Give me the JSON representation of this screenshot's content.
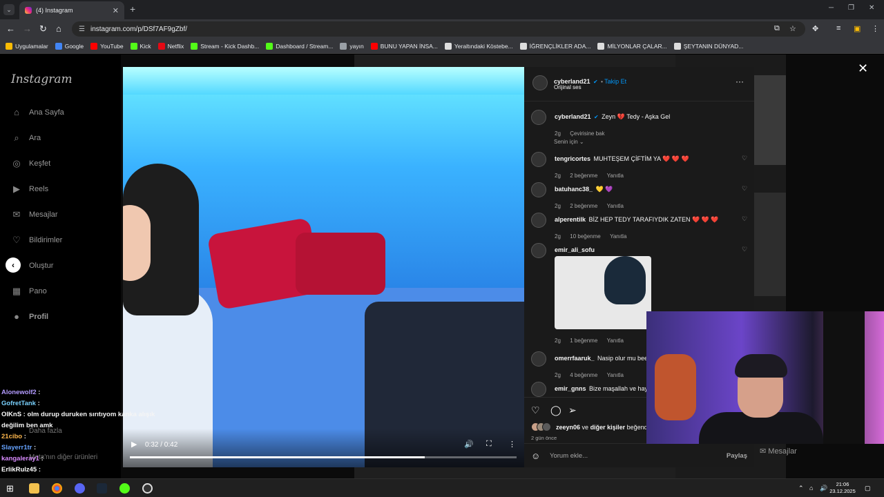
{
  "browser": {
    "tab_title": "(4) Instagram",
    "tab_close": "✕",
    "new_tab": "+",
    "url": "instagram.com/p/DSf7AF9gZbf/",
    "bookmarks": [
      {
        "label": "Uygulamalar",
        "color": "#fbbc05"
      },
      {
        "label": "Google",
        "color": "#4285f4"
      },
      {
        "label": "YouTube",
        "color": "#ff0000"
      },
      {
        "label": "Kick",
        "color": "#53fc18"
      },
      {
        "label": "Netflix",
        "color": "#e50914"
      },
      {
        "label": "Stream - Kick Dashb...",
        "color": "#53fc18"
      },
      {
        "label": "Dashboard / Stream...",
        "color": "#53fc18"
      },
      {
        "label": "yayın",
        "color": "#9aa0a6"
      },
      {
        "label": "BUNU YAPAN İNSA...",
        "color": "#ff0000"
      },
      {
        "label": "Yeraltındaki Köstebe...",
        "color": "#dddddd"
      },
      {
        "label": "İĞRENÇLİKLER ADA...",
        "color": "#dddddd"
      },
      {
        "label": "MİLYONLAR ÇALAR...",
        "color": "#dddddd"
      },
      {
        "label": "ŞEYTANIN DÜNYAD...",
        "color": "#dddddd"
      }
    ]
  },
  "instagram": {
    "logo": "Instagram",
    "nav": [
      "Ana Sayfa",
      "Ara",
      "Keşfet",
      "Reels",
      "Mesajlar",
      "Bildirimler",
      "Oluştur",
      "Pano",
      "Profil"
    ],
    "more": "Daha fazla",
    "meta_products": "Meta'nın diğer ürünleri",
    "messages_dock": "Mesajlar"
  },
  "post": {
    "author": "cyberland21",
    "follow": "Takip Et",
    "audio": "Orijinal ses",
    "more_icon": "···",
    "caption_user": "cyberland21",
    "caption_text": "Zeyn 💔 Tedy - Aşka Gel",
    "caption_age": "2g",
    "caption_translate": "Çevirisine bak",
    "sort_label": "Senin için",
    "comments": [
      {
        "user": "tengricortes",
        "text": "MUHTEŞEM ÇİFTİM YA ❤️ ❤️ ❤️",
        "age": "2g",
        "likes": "2 beğenme",
        "reply": "Yanıtla"
      },
      {
        "user": "batuhanc38_",
        "text": "💛 💜",
        "age": "2g",
        "likes": "2 beğenme",
        "reply": "Yanıtla"
      },
      {
        "user": "alperentilk",
        "text": "BİZ HEP TEDY TARAFIYDIK ZATEN ❤️ ❤️ ❤️",
        "age": "2g",
        "likes": "10 beğenme",
        "reply": "Yanıtla"
      },
      {
        "user": "emir_ali_sofu",
        "text": "",
        "age": "2g",
        "likes": "1 beğenme",
        "reply": "Yanıtla"
      },
      {
        "user": "omerrfaaruk_",
        "text": "Nasip olur mu bee",
        "age": "2g",
        "likes": "4 beğenme",
        "reply": "Yanıtla"
      },
      {
        "user": "emir_gnns",
        "text": "Bize maşallah ve hayır",
        "age": "",
        "likes": "",
        "reply": ""
      }
    ],
    "liked_by_user": "zeeyn06",
    "liked_by_rest": "ve",
    "liked_by_others": "diğer kişiler",
    "liked_suffix": "beğendi",
    "posted_ago": "2 gün önce",
    "comment_placeholder": "Yorum ekle...",
    "share": "Paylaş"
  },
  "video": {
    "time": "0:32 / 0:42",
    "progress": 0.762
  },
  "stream_chat": [
    {
      "user": "Alonewolf2",
      "suffix": " :",
      "text": "",
      "color": "#b39bff"
    },
    {
      "user": "GofretTank",
      "suffix": " :",
      "text": "",
      "color": "#7ad2ff"
    },
    {
      "user": "OlKnS",
      "suffix": " :",
      "text": " olm durup duruken sırıtıyom kanka alışık",
      "color": "#ffffff"
    },
    {
      "user": "",
      "suffix": "",
      "text": "değilim ben amk",
      "color": "#ffffff"
    },
    {
      "user": "21cibo",
      "suffix": " :",
      "text": "",
      "color": "#ffb84d"
    },
    {
      "user": "Slayerr1tr",
      "suffix": " :",
      "text": "",
      "color": "#66a3ff"
    },
    {
      "user": "kangaleray1",
      "suffix": " :",
      "text": "",
      "color": "#d98cff"
    },
    {
      "user": "ErlikRulz45",
      "suffix": " :",
      "text": "",
      "color": "#ffffff"
    }
  ],
  "taskbar": {
    "time": "21:06",
    "date": "23.12.2025"
  }
}
